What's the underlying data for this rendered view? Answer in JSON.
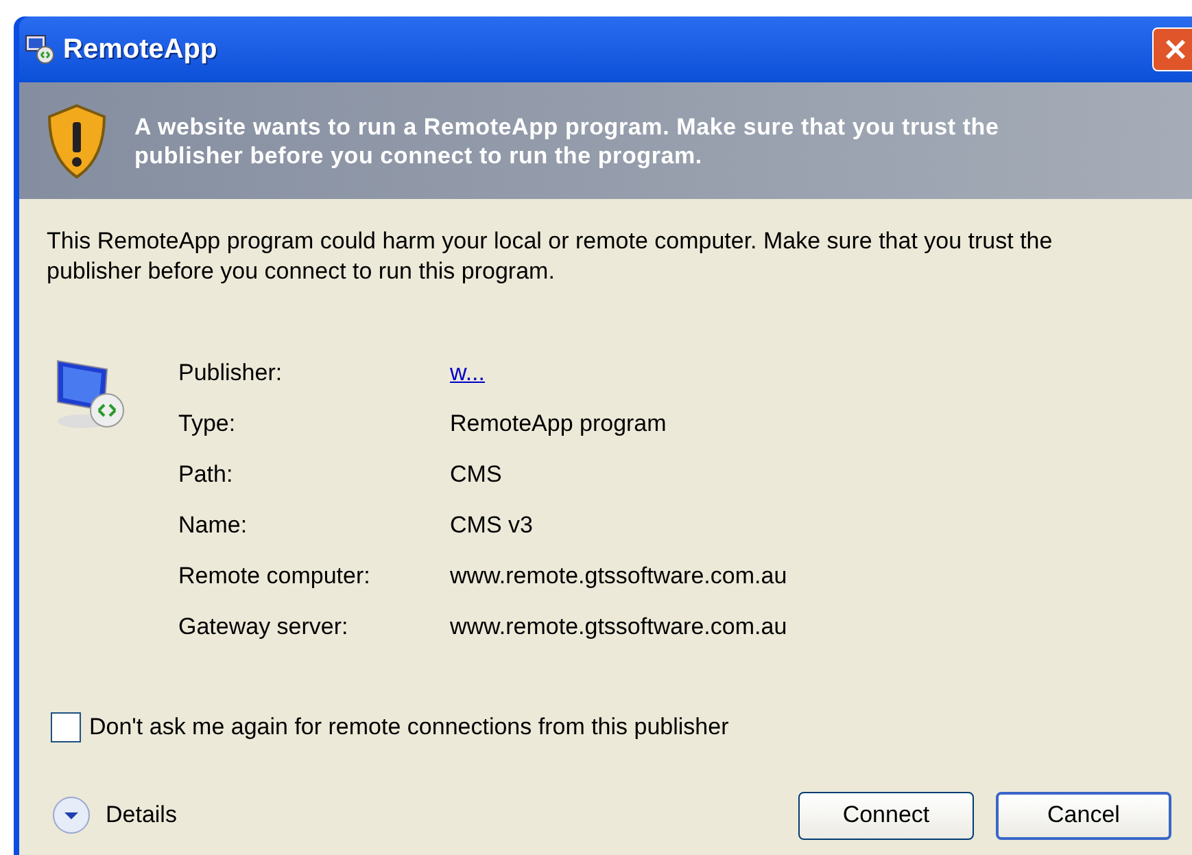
{
  "window": {
    "title": "RemoteApp"
  },
  "banner": {
    "text": "A website wants to run a RemoteApp program. Make sure that you trust the publisher before you connect to run the program."
  },
  "message": "This RemoteApp program could harm your local or remote computer. Make sure that you trust the publisher before you connect to run this program.",
  "properties": [
    {
      "label": "Publisher:",
      "value": "w...",
      "kind": "link"
    },
    {
      "label": "Type:",
      "value": "RemoteApp program",
      "kind": "text"
    },
    {
      "label": "Path:",
      "value": "CMS",
      "kind": "text"
    },
    {
      "label": "Name:",
      "value": "CMS v3",
      "kind": "text"
    },
    {
      "label": "Remote computer:",
      "value": "www.remote.gtssoftware.com.au",
      "kind": "text"
    },
    {
      "label": "Gateway server:",
      "value": "www.remote.gtssoftware.com.au",
      "kind": "text"
    }
  ],
  "dont_ask": {
    "label": "Don't ask me again for remote connections from this publisher",
    "checked": false
  },
  "details": {
    "label": "Details",
    "expanded": false
  },
  "buttons": [
    {
      "label": "Connect",
      "default": false
    },
    {
      "label": "Cancel",
      "default": true
    }
  ]
}
